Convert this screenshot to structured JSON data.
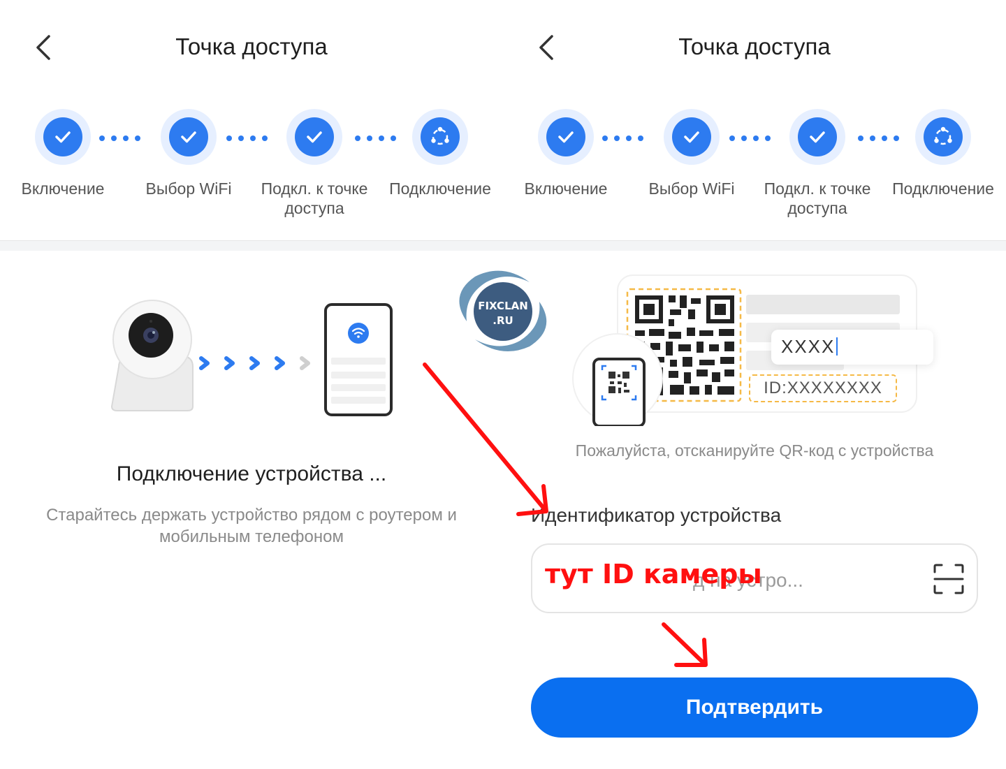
{
  "left": {
    "header": {
      "title": "Точка доступа"
    },
    "steps": [
      {
        "label": "Включение",
        "state": "done"
      },
      {
        "label": "Выбор WiFi",
        "state": "done"
      },
      {
        "label": "Подкл. к точке доступа",
        "state": "done"
      },
      {
        "label": "Подключение",
        "state": "current"
      }
    ],
    "connecting_title": "Подключение устройства ...",
    "connecting_hint": "Старайтесь держать устройство рядом с роутером и мобильным телефоном"
  },
  "right": {
    "header": {
      "title": "Точка доступа"
    },
    "steps": [
      {
        "label": "Включение",
        "state": "done"
      },
      {
        "label": "Выбор WiFi",
        "state": "done"
      },
      {
        "label": "Подкл. к точке доступа",
        "state": "done"
      },
      {
        "label": "Подключение",
        "state": "current"
      }
    ],
    "illustration": {
      "sample_code": "XXXX",
      "sample_id": "ID:XXXXXXXX"
    },
    "scan_hint": "Пожалуйста, отсканируйте QR-код с устройства",
    "device_id_label": "Идентификатор устройства",
    "device_id_placeholder": "д на устро...",
    "annotation": "тут ID камеры",
    "confirm_label": "Подтвердить"
  },
  "watermark": {
    "line1": "FIXCLAN",
    "line2": ".RU"
  },
  "colors": {
    "accent": "#2d7bf0",
    "button": "#0a6ff0",
    "annotation": "#ff1010",
    "step_halo": "#e6efff"
  },
  "icons": {
    "back": "chevron-left-icon",
    "step_done": "check-icon",
    "step_current": "connect-nodes-icon",
    "wifi": "wifi-icon",
    "scan": "scan-frame-icon"
  }
}
